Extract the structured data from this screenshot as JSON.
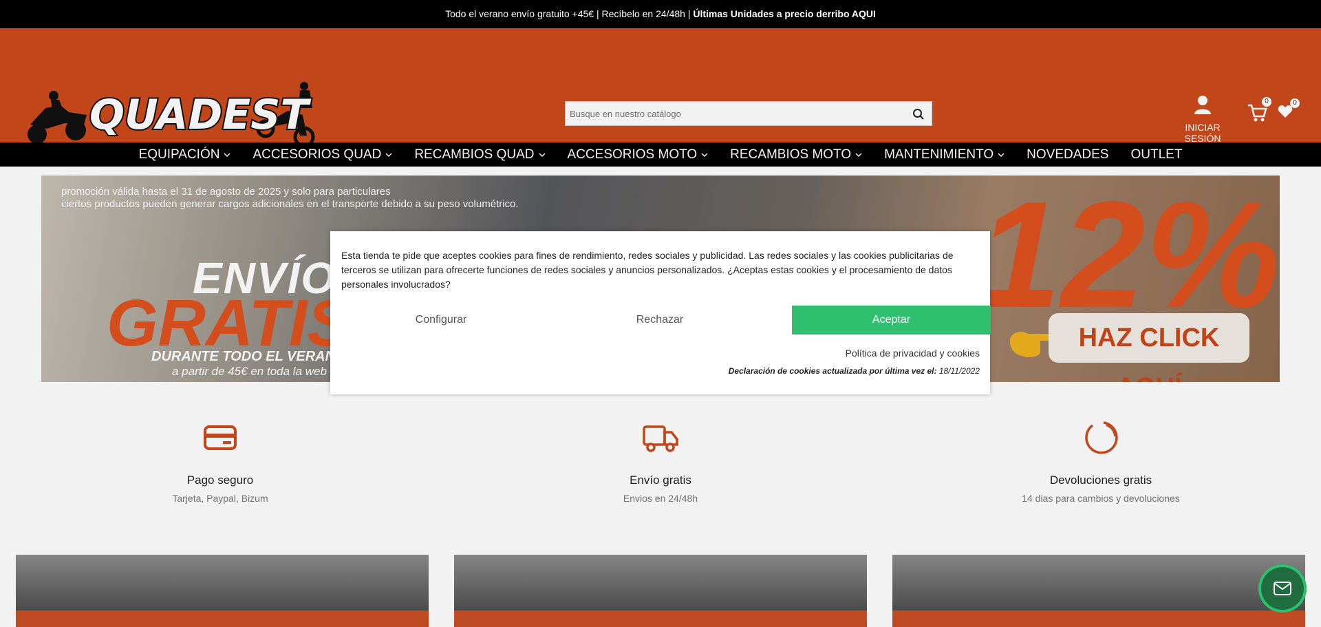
{
  "topbar": {
    "text": "Todo el verano envío gratuito +45€ | Recíbelo en 24/48h | ",
    "bold": "Últimas Unidades a precio derribo AQUI"
  },
  "header": {
    "logo_text": "QUADEST",
    "search_placeholder": "Busque en nuestro catálogo",
    "account_label": "INICIAR SESIÓN",
    "cart_count": "0",
    "wishlist_count": "0"
  },
  "nav": {
    "items": [
      {
        "label": "EQUIPACIÓN",
        "dropdown": true
      },
      {
        "label": "ACCESORIOS QUAD",
        "dropdown": true
      },
      {
        "label": "RECAMBIOS QUAD",
        "dropdown": true
      },
      {
        "label": "ACCESORIOS MOTO",
        "dropdown": true
      },
      {
        "label": "RECAMBIOS MOTO",
        "dropdown": true
      },
      {
        "label": "MANTENIMIENTO",
        "dropdown": true
      },
      {
        "label": "NOVEDADES",
        "dropdown": false
      },
      {
        "label": "OUTLET",
        "dropdown": false
      }
    ]
  },
  "banner": {
    "note_line1": "promoción válida hasta el 31 de agosto de 2025  y solo para particulares",
    "note_line2": "ciertos productos pueden generar cargos adicionales en el transporte debido a su peso volumétrico.",
    "envio": "ENVÍO",
    "gratis": "GRATIS",
    "durante": "DURANTE TODO EL VERANO",
    "apartir": "a partir de 45€ en toda la web",
    "percent": "12%",
    "cta": "HAZ CLICK AQUÍ"
  },
  "features": [
    {
      "icon": "credit-card-icon",
      "title": "Pago seguro",
      "sub": "Tarjeta, Paypal, Bizum"
    },
    {
      "icon": "truck-icon",
      "title": "Envío gratis",
      "sub": "Envios en 24/48h"
    },
    {
      "icon": "loading-spinner-icon",
      "title": "Devoluciones gratis",
      "sub": "14 dias para cambios y devoluciones"
    }
  ],
  "cookie": {
    "text": "Esta tienda te pide que aceptes cookies para fines de rendimiento, redes sociales y publicidad. Las redes sociales y las cookies publicitarias de terceros se utilizan para ofrecerte funciones de redes sociales y anuncios personalizados. ¿Aceptas estas cookies y el procesamiento de datos personales involucrados?",
    "configurar": "Configurar",
    "rechazar": "Rechazar",
    "aceptar": "Aceptar",
    "policy": "Política de privacidad y cookies",
    "decl_label": "Declaración de cookies actualizada por última vez el:",
    "decl_date": "18/11/2022"
  },
  "colors": {
    "brand_orange": "#cc4a1b",
    "accept_green": "#2ebf6f",
    "chat_green": "#1f6d3e"
  }
}
